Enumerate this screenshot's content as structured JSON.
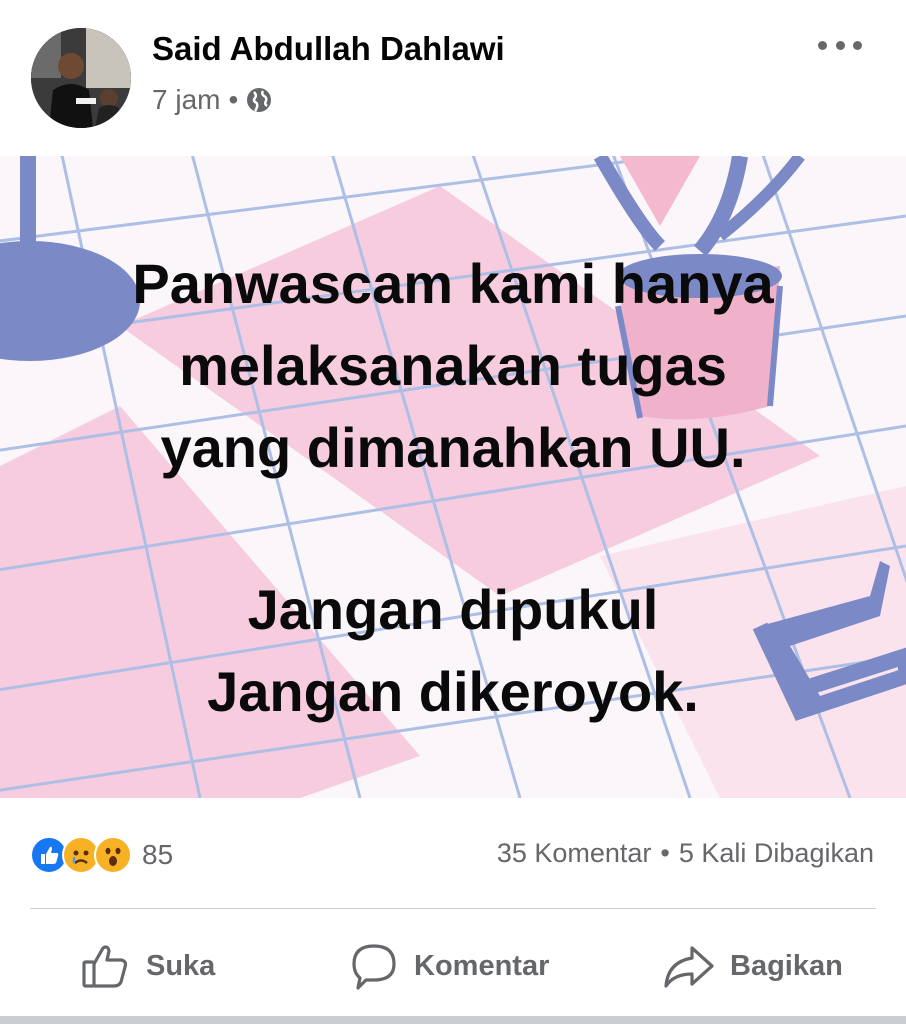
{
  "post": {
    "author": "Said Abdullah Dahlawi",
    "time": "7 jam",
    "separator": "•",
    "audience_icon": "globe-icon",
    "menu_icon": "more-options-icon"
  },
  "image_text": {
    "lines": [
      "Panwascam kami hanya",
      "melaksanakan tugas",
      "yang dimanahkan UU.",
      "Jangan dipukul",
      "Jangan dikeroyok."
    ]
  },
  "stats": {
    "reaction_icons": [
      "like-icon",
      "sad-icon",
      "wow-icon"
    ],
    "reaction_count": "85",
    "comments": "35 Komentar",
    "separator": "•",
    "shares": "5 Kali Dibagikan"
  },
  "actions": {
    "like_label": "Suka",
    "comment_label": "Komentar",
    "share_label": "Bagikan"
  },
  "colors": {
    "accent_blue": "#1877f2",
    "secondary_text": "#65676b",
    "reaction_yellow": "#f7b125",
    "image_pink": "#f7c9dd",
    "image_blue": "#7b8ac6"
  }
}
